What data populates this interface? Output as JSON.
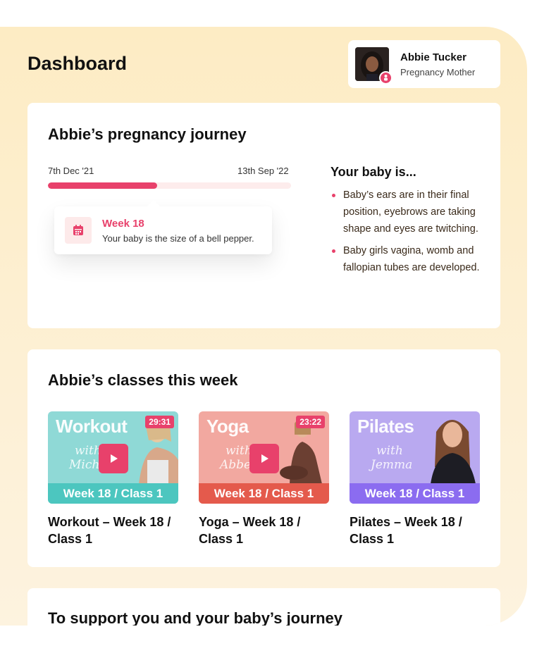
{
  "page": {
    "title": "Dashboard"
  },
  "user": {
    "name": "Abbie Tucker",
    "role": "Pregnancy Mother",
    "avatar_icon": "user-avatar",
    "badge_icon": "baby-icon"
  },
  "journey": {
    "title": "Abbie’s pregnancy journey",
    "start_date": "7th Dec '21",
    "end_date": "13th Sep '22",
    "progress_fraction": 0.45,
    "week_label": "Week 18",
    "week_text": "Your baby is the size of a bell pepper.",
    "week_icon": "calendar-icon",
    "baby_title": "Your baby is...",
    "baby_facts": [
      "Baby’s ears are in their final position, eyebrows are taking shape and eyes are twitching.",
      "Baby girls vagina, womb and fallopian tubes are developed."
    ]
  },
  "classes": {
    "title": "Abbie’s classes this week",
    "items": [
      {
        "thumb_name": "Workout",
        "thumb_with": "with",
        "thumb_instructor": "Michelle",
        "duration": "29:31",
        "strip": "Week 18 / Class 1",
        "title": "Workout – Week 18 / Class 1",
        "color_bg": "#8fd9d6",
        "color_strip": "#4cc6bf"
      },
      {
        "thumb_name": "Yoga",
        "thumb_with": "with",
        "thumb_instructor": "Abbey",
        "duration": "23:22",
        "strip": "Week 18 / Class 1",
        "title": "Yoga – Week 18 / Class 1",
        "color_bg": "#f2a8a0",
        "color_strip": "#e45a4c"
      },
      {
        "thumb_name": "Pilates",
        "thumb_with": "with",
        "thumb_instructor": "Jemma",
        "duration": "",
        "strip": "Week 18 / Class 1",
        "title": "Pilates – Week 18 / Class 1",
        "color_bg": "#b9a9f0",
        "color_strip": "#8b6cf0"
      }
    ]
  },
  "support": {
    "title": "To support you and your baby’s journey"
  },
  "colors": {
    "accent": "#e8416b",
    "panel": "#fdecc4"
  }
}
